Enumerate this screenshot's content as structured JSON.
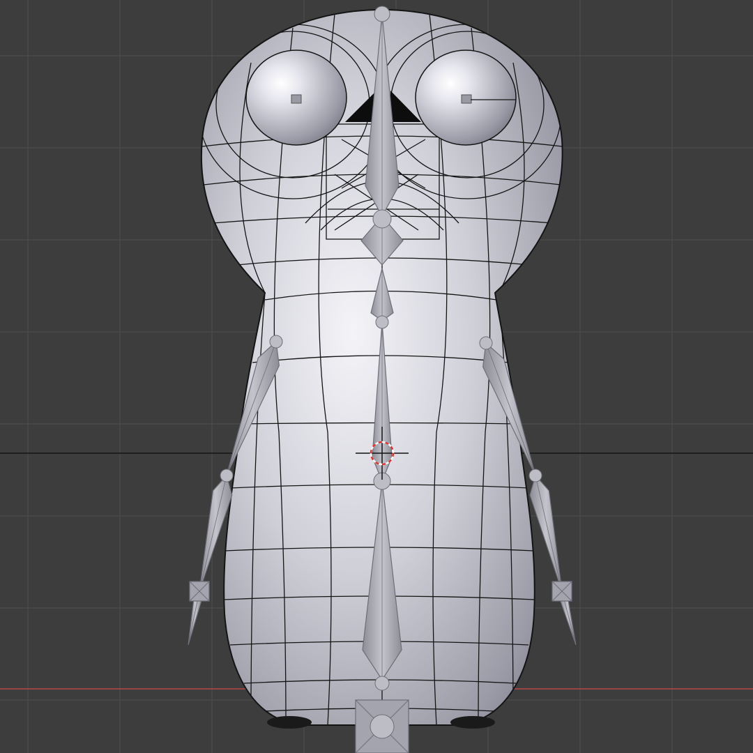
{
  "viewport": {
    "colors": {
      "background": "#3d3d3d",
      "grid": "#4a4a4a",
      "horizon": "#1e1e1e",
      "x_axis": "#b84848",
      "mesh": "#cfcfd6",
      "wire": "#141414",
      "bone": "#a9a9b2",
      "bone_edge": "#6e6e78",
      "cursor_ring_red": "#e23030",
      "cursor_ring_white": "#ffffff"
    },
    "object": {
      "shading": "solid",
      "wireframe_overlay": true,
      "armature_display": "octahedral"
    }
  }
}
